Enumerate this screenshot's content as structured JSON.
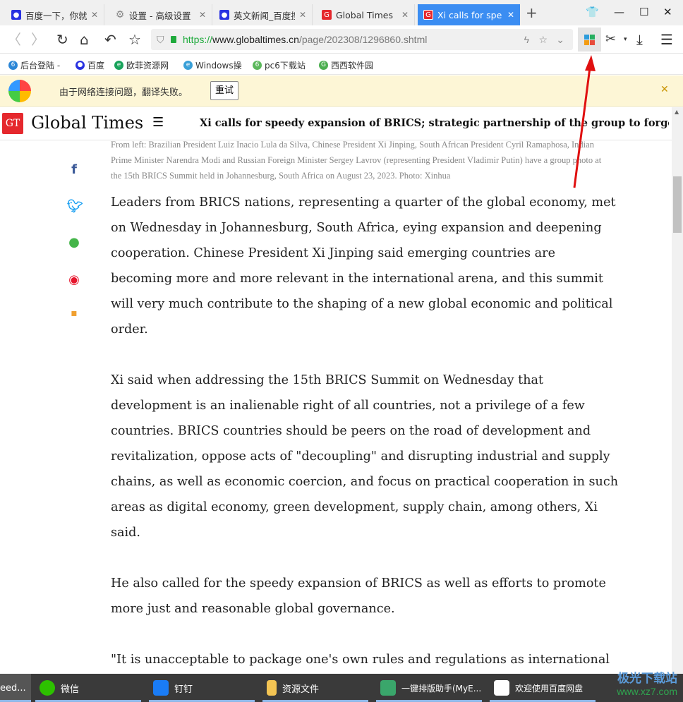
{
  "tabs": [
    {
      "label": "百度一下，你就",
      "icon": "baidu-paw-icon"
    },
    {
      "label": "设置 - 高级设置",
      "icon": "gear-icon"
    },
    {
      "label": "英文新闻_百度搜",
      "icon": "baidu-paw-icon"
    },
    {
      "label": "Global Times",
      "icon": "gt-g-icon"
    },
    {
      "label": "Xi calls for spe",
      "icon": "gt-g-icon",
      "active": true
    }
  ],
  "url": {
    "scheme": "https://",
    "host": "www.globaltimes.cn",
    "path": "/page/202308/1296860.shtml"
  },
  "bookmarks": [
    "后台登陆 -",
    "百度",
    "欧菲资源网",
    "Windows操",
    "pc6下载站",
    "西西软件园"
  ],
  "notice": {
    "text": "由于网络连接问题，翻译失败。",
    "retry": "重试"
  },
  "site": {
    "logo_mark": "GT",
    "logo_text": "Global Times",
    "headline": "Xi calls for speedy expansion of BRICS; strategic partnership of the group to forge stronger, deeper ..."
  },
  "caption": "From left: Brazilian President Luiz Inacio Lula da Silva, Chinese President Xi Jinping, South African President Cyril Ramaphosa, Indian Prime Minister Narendra Modi and Russian Foreign Minister Sergey Lavrov (representing President Vladimir Putin) have a group photo at the 15th BRICS Summit held in Johannesburg, South Africa on August 23, 2023. Photo: Xinhua",
  "paragraphs": [
    "Leaders from BRICS nations, representing a quarter of the global economy, met on Wednesday in Johannesburg, South Africa, eying expansion and deepening cooperation. Chinese President Xi Jinping said emerging countries are becoming more and more relevant in the international arena, and this summit will very much contribute to the shaping of a new global economic and political order.",
    "Xi said when addressing the 15th BRICS Summit on Wednesday that development is an inalienable right of all countries, not a privilege of a few countries. BRICS countries should be peers on the road of development and revitalization, oppose acts of \"decoupling\" and disrupting industrial and supply chains, as well as economic coercion, and focus on practical cooperation in such areas as digital economy, green development, supply chain, among others, Xi said.",
    "He also called for the speedy expansion of BRICS as well as efforts to promote more just and reasonable global governance.",
    "\"It is unacceptable to package one's own rules and regulations as international"
  ],
  "taskbar": [
    {
      "label": "eed...",
      "icon": "browser-icon"
    },
    {
      "label": "微信",
      "icon": "wechat-icon"
    },
    {
      "label": "钉钉",
      "icon": "dingtalk-icon"
    },
    {
      "label": "资源文件",
      "icon": "folder-icon"
    },
    {
      "label": "一键排版助手(MyE...",
      "icon": "myeditor-icon"
    },
    {
      "label": "欢迎使用百度网盘",
      "icon": "baidu-netdisk-icon"
    }
  ],
  "watermark": {
    "text": "极光下载站",
    "url": "www.xz7.com"
  },
  "colors": {
    "active_tab": "#3b8df2",
    "gt_red": "#e5282d",
    "notice_bg": "#fdf6d6",
    "taskbar": "#3a3a3a",
    "arrow": "#e01010"
  }
}
